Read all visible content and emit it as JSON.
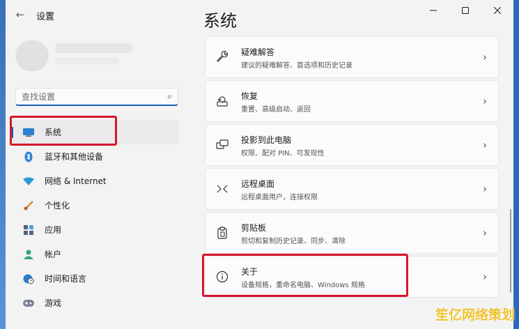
{
  "window": {
    "title": "设置",
    "controls": [
      "minimize-icon",
      "maximize-icon",
      "close-icon"
    ]
  },
  "search": {
    "placeholder": "查找设置",
    "value": ""
  },
  "sidebar": {
    "items": [
      {
        "label": "系统",
        "icon": "system-icon",
        "active": true
      },
      {
        "label": "蓝牙和其他设备",
        "icon": "bluetooth-icon"
      },
      {
        "label": "网络 & Internet",
        "icon": "network-icon"
      },
      {
        "label": "个性化",
        "icon": "brush-icon"
      },
      {
        "label": "应用",
        "icon": "apps-icon"
      },
      {
        "label": "帐户",
        "icon": "account-icon"
      },
      {
        "label": "时间和语言",
        "icon": "globe-clock-icon"
      },
      {
        "label": "游戏",
        "icon": "gamepad-icon"
      }
    ]
  },
  "main": {
    "title": "系统",
    "cards": [
      {
        "title": "疑难解答",
        "subtitle": "建议的疑难解答、首选项和历史记录",
        "icon": "wrench-icon"
      },
      {
        "title": "恢复",
        "subtitle": "重置、高级启动、返回",
        "icon": "recovery-icon"
      },
      {
        "title": "投影到此电脑",
        "subtitle": "权限、配对 PIN、可发现性",
        "icon": "project-icon"
      },
      {
        "title": "远程桌面",
        "subtitle": "远程桌面用户，连接权限",
        "icon": "remote-desktop-icon"
      },
      {
        "title": "剪贴板",
        "subtitle": "剪切和复制历史记录、同步、清除",
        "icon": "clipboard-icon"
      },
      {
        "title": "关于",
        "subtitle": "设备规格，重命名电脑、Windows 规格",
        "icon": "info-icon"
      }
    ]
  },
  "watermark": "笙亿网络策划",
  "colors": {
    "accent": "#1a5fb4",
    "highlight_box": "#d4162a",
    "background": "#f3f3f3",
    "card": "#fbfbfb"
  }
}
